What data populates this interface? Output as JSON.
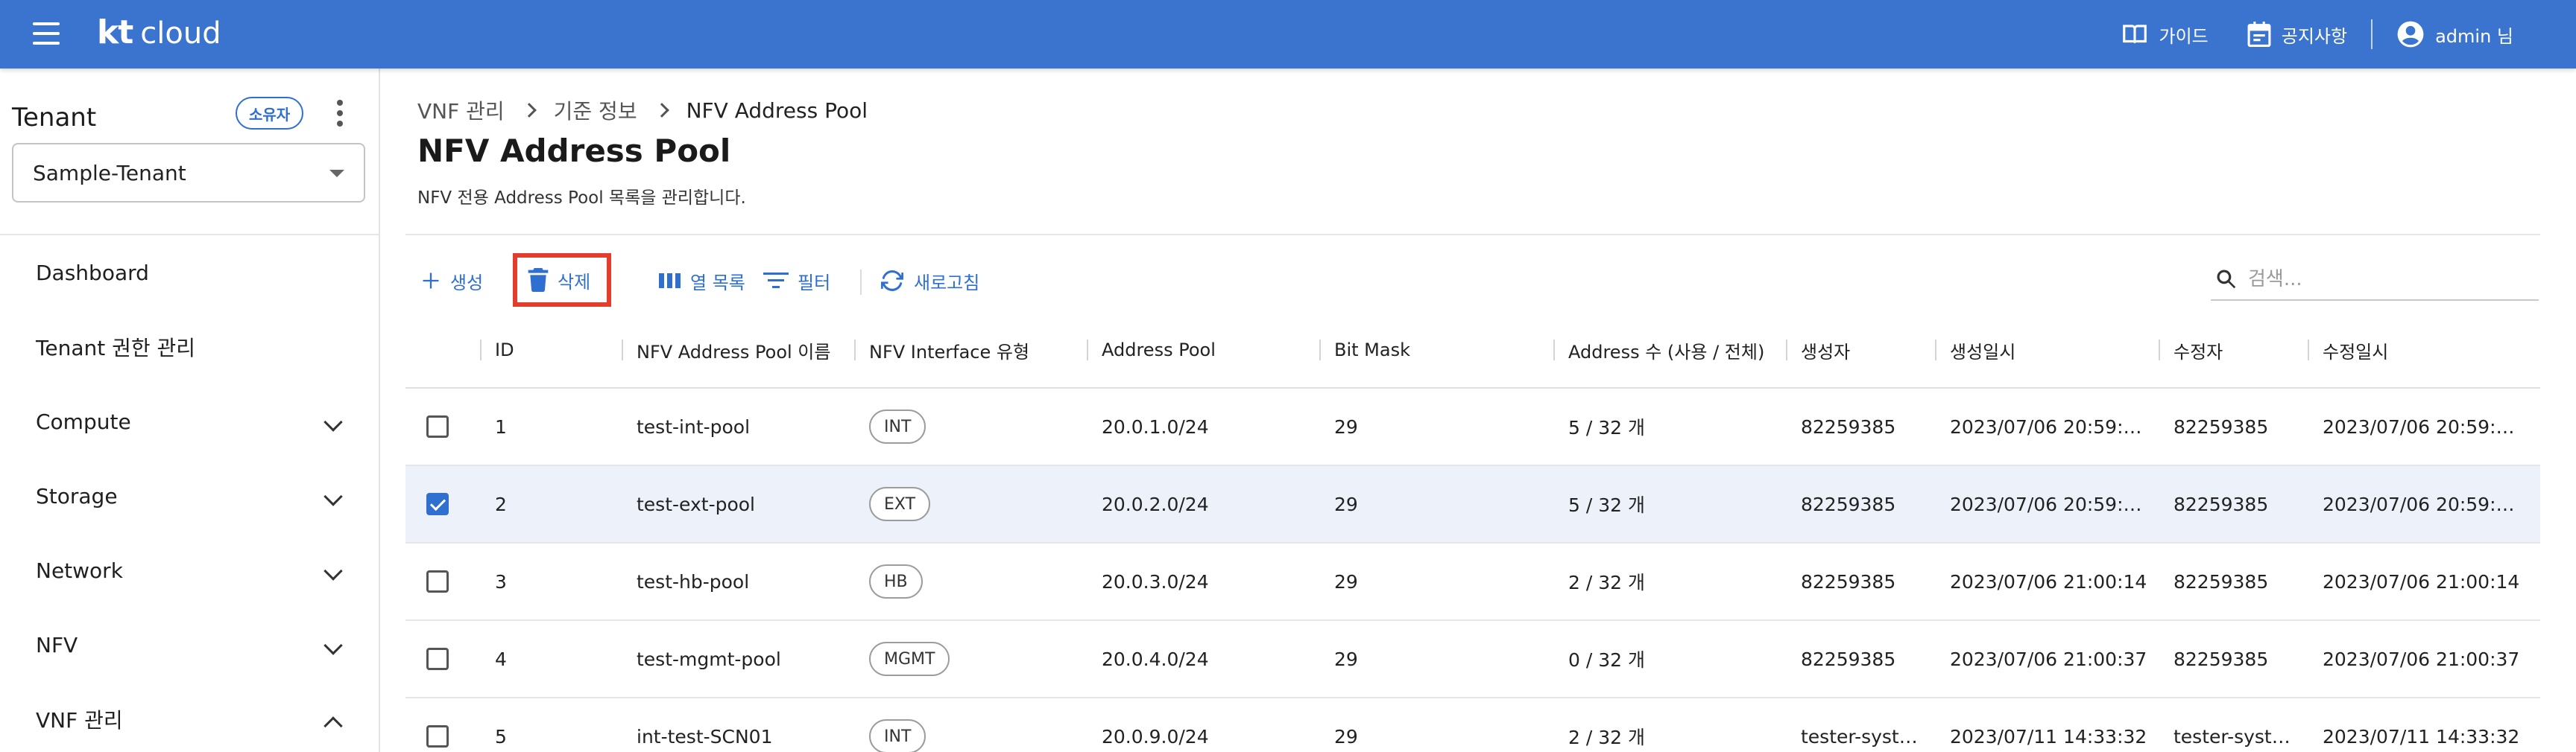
{
  "app": {
    "logo_kt": "kt",
    "logo_cloud": "cloud",
    "top_actions": [
      {
        "label": "가이드",
        "icon": "book-icon"
      },
      {
        "label": "공지사항",
        "icon": "calendar-icon"
      },
      {
        "label": "admin 님",
        "icon": "account-circle-icon"
      }
    ]
  },
  "sidebar": {
    "tenant_title": "Tenant",
    "owner_badge": "소유자",
    "tenant_selected": "Sample-Tenant",
    "items": [
      {
        "label": "Dashboard",
        "expandable": false
      },
      {
        "label": "Tenant 권한 관리",
        "expandable": false
      },
      {
        "label": "Compute",
        "expandable": true,
        "expanded": false
      },
      {
        "label": "Storage",
        "expandable": true,
        "expanded": false
      },
      {
        "label": "Network",
        "expandable": true,
        "expanded": false
      },
      {
        "label": "NFV",
        "expandable": true,
        "expanded": false
      },
      {
        "label": "VNF 관리",
        "expandable": true,
        "expanded": true
      }
    ]
  },
  "breadcrumb": [
    "VNF 관리",
    "기준 정보",
    "NFV Address Pool"
  ],
  "page": {
    "title": "NFV Address Pool",
    "description": "NFV 전용 Address Pool 목록을 관리합니다."
  },
  "toolbar": {
    "create": "생성",
    "delete": "삭제",
    "columns": "열 목록",
    "filter": "필터",
    "refresh": "새로고침",
    "search_placeholder": "검색..."
  },
  "table": {
    "headers": [
      "ID",
      "NFV Address Pool 이름",
      "NFV Interface 유형",
      "Address Pool",
      "Bit Mask",
      "Address 수 (사용 / 전체)",
      "생성자",
      "생성일시",
      "수정자",
      "수정일시"
    ],
    "rows": [
      {
        "checked": false,
        "cells": [
          "1",
          "test-int-pool",
          "INT",
          "20.0.1.0/24",
          "29",
          "5 / 32 개",
          "82259385",
          "2023/07/06 20:59:…",
          "82259385",
          "2023/07/06 20:59:…"
        ]
      },
      {
        "checked": true,
        "cells": [
          "2",
          "test-ext-pool",
          "EXT",
          "20.0.2.0/24",
          "29",
          "5 / 32 개",
          "82259385",
          "2023/07/06 20:59:…",
          "82259385",
          "2023/07/06 20:59:…"
        ]
      },
      {
        "checked": false,
        "cells": [
          "3",
          "test-hb-pool",
          "HB",
          "20.0.3.0/24",
          "29",
          "2 / 32 개",
          "82259385",
          "2023/07/06 21:00:14",
          "82259385",
          "2023/07/06 21:00:14"
        ]
      },
      {
        "checked": false,
        "cells": [
          "4",
          "test-mgmt-pool",
          "MGMT",
          "20.0.4.0/24",
          "29",
          "0 / 32 개",
          "82259385",
          "2023/07/06 21:00:37",
          "82259385",
          "2023/07/06 21:00:37"
        ]
      },
      {
        "checked": false,
        "cells": [
          "5",
          "int-test-SCN01",
          "INT",
          "20.0.9.0/24",
          "29",
          "2 / 32 개",
          "tester-syst…",
          "2023/07/11 14:33:32",
          "tester-syst…",
          "2023/07/11 14:33:32"
        ]
      }
    ]
  },
  "colors": {
    "appbar": "#3a74cf",
    "accent": "#2f6fd0",
    "highlight_border": "#e53d2b",
    "selected_row": "#edf2fa"
  }
}
